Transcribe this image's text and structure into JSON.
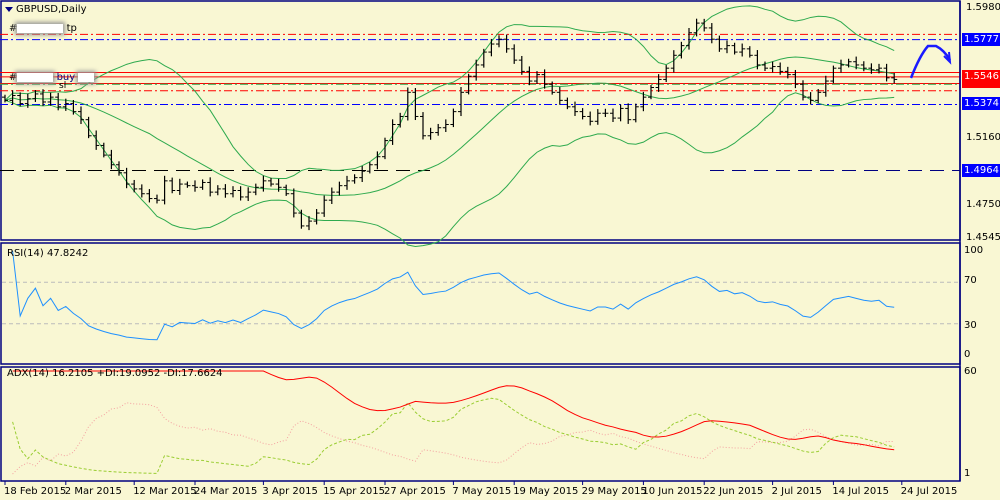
{
  "header": {
    "symbol_title": "GBPUSD,Daily"
  },
  "trade_labels": {
    "tp": "tp",
    "buy": "buy",
    "sl": "sl",
    "hash": "#"
  },
  "price_axis": {
    "ticks": [
      "1.5980",
      "1.5160",
      "1.4750",
      "1.4545"
    ],
    "boxes": [
      {
        "label": "1.5777",
        "color": "#0000ff"
      },
      {
        "label": "1.5546",
        "color": "#ff0000"
      },
      {
        "label": "1.5374",
        "color": "#0000ff"
      },
      {
        "label": "1.4964",
        "color": "#0000ff"
      }
    ]
  },
  "rsi": {
    "title": "RSI(14) 47.8242",
    "ticks": [
      "100",
      "70",
      "30",
      "0"
    ]
  },
  "adx": {
    "title": "ADX(14) 16.2105 +DI:19.0952 -DI:17.6624",
    "ticks": [
      "60",
      "1"
    ]
  },
  "dates": [
    "18 Feb 2015",
    "2 Mar 2015",
    "12 Mar 2015",
    "24 Mar 2015",
    "3 Apr 2015",
    "15 Apr 2015",
    "27 Apr 2015",
    "7 May 2015",
    "19 May 2015",
    "29 May 2015",
    "10 Jun 2015",
    "22 Jun 2015",
    "2 Jul 2015",
    "14 Jul 2015",
    "24 Jul 2015"
  ],
  "colors": {
    "background": "#f9f7d3",
    "frame": "#000080",
    "bands": "#2eaa4e",
    "rsi": "#1e90ff",
    "adx": "#ff0000",
    "plus_di": "#9acd32",
    "minus_di": "#f4a0a0"
  },
  "chart_data": {
    "type": "ohlc",
    "title": "GBPUSD,Daily",
    "ylim": [
      1.4545,
      1.598
    ],
    "levels": {
      "tp": 1.581,
      "tp_blue": 1.5777,
      "entry": [
        1.5573,
        1.5546,
        1.5505
      ],
      "sl": 1.546,
      "support": 1.5374,
      "lower": 1.4964
    },
    "close": [
      1.54,
      1.543,
      1.538,
      1.541,
      1.544,
      1.539,
      1.542,
      1.536,
      1.538,
      1.533,
      1.528,
      1.518,
      1.512,
      1.506,
      1.5,
      1.495,
      1.488,
      1.485,
      1.482,
      1.479,
      1.478,
      1.49,
      1.484,
      1.488,
      1.487,
      1.486,
      1.489,
      1.483,
      1.485,
      1.482,
      1.484,
      1.48,
      1.483,
      1.486,
      1.49,
      1.488,
      1.486,
      1.482,
      1.47,
      1.462,
      1.465,
      1.47,
      1.478,
      1.483,
      1.487,
      1.49,
      1.492,
      1.496,
      1.5,
      1.505,
      1.515,
      1.525,
      1.53,
      1.545,
      1.53,
      1.518,
      1.52,
      1.523,
      1.525,
      1.533,
      1.545,
      1.555,
      1.562,
      1.57,
      1.575,
      1.578,
      1.572,
      1.565,
      1.558,
      1.552,
      1.556,
      1.55,
      1.545,
      1.54,
      1.536,
      1.533,
      1.53,
      1.527,
      1.532,
      1.532,
      1.529,
      1.535,
      1.528,
      1.536,
      1.542,
      1.548,
      1.553,
      1.56,
      1.568,
      1.574,
      1.582,
      1.588,
      1.585,
      1.578,
      1.572,
      1.574,
      1.57,
      1.572,
      1.568,
      1.562,
      1.56,
      1.561,
      1.558,
      1.556,
      1.55,
      1.542,
      1.54,
      1.545,
      1.552,
      1.56,
      1.562,
      1.564,
      1.562,
      1.56,
      1.559,
      1.56,
      1.554,
      1.553
    ],
    "rsi_levels": [
      70,
      30
    ],
    "rsi_ylim": [
      0,
      100
    ],
    "adx_ylim": [
      1,
      60
    ]
  }
}
